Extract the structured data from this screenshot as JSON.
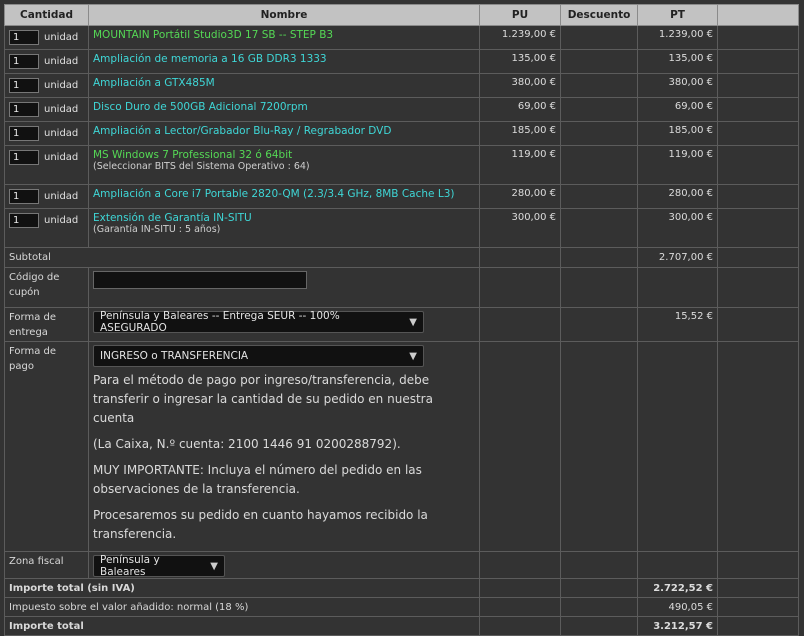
{
  "headers": {
    "quantity": "Cantidad",
    "name": "Nombre",
    "unit_price": "PU",
    "discount": "Descuento",
    "total_price": "PT"
  },
  "items": [
    {
      "qty": "1",
      "unit": "unidad",
      "name": "MOUNTAIN Portátil Studio3D 17 SB -- STEP B3",
      "sub": "",
      "pu": "1.239,00 €",
      "pt": "1.239,00 €",
      "color": "#55d955"
    },
    {
      "qty": "1",
      "unit": "unidad",
      "name": "Ampliación de memoria a 16 GB DDR3 1333",
      "sub": "",
      "pu": "135,00 €",
      "pt": "135,00 €",
      "color": "#3fd7d7"
    },
    {
      "qty": "1",
      "unit": "unidad",
      "name": "Ampliación a GTX485M",
      "sub": "",
      "pu": "380,00 €",
      "pt": "380,00 €",
      "color": "#3fd7d7"
    },
    {
      "qty": "1",
      "unit": "unidad",
      "name": "Disco Duro de 500GB Adicional 7200rpm",
      "sub": "",
      "pu": "69,00 €",
      "pt": "69,00 €",
      "color": "#3fd7d7"
    },
    {
      "qty": "1",
      "unit": "unidad",
      "name": "Ampliación a Lector/Grabador Blu-Ray / Regrabador DVD",
      "sub": "",
      "pu": "185,00 €",
      "pt": "185,00 €",
      "color": "#3fd7d7"
    },
    {
      "qty": "1",
      "unit": "unidad",
      "name": "MS Windows 7 Professional 32 ó 64bit",
      "sub": "(Seleccionar BITS del Sistema Operativo : 64)",
      "pu": "119,00 €",
      "pt": "119,00 €",
      "color": "#55d955"
    },
    {
      "qty": "1",
      "unit": "unidad",
      "name": "Ampliación a Core i7 Portable 2820-QM (2.3/3.4 GHz, 8MB Cache L3)",
      "sub": "",
      "pu": "280,00 €",
      "pt": "280,00 €",
      "color": "#3fd7d7"
    },
    {
      "qty": "1",
      "unit": "unidad",
      "name": "Extensión de Garantía IN-SITU",
      "sub": "(Garantía IN-SITU : 5 años)",
      "pu": "300,00 €",
      "pt": "300,00 €",
      "color": "#3fd7d7"
    }
  ],
  "subtotal": {
    "label": "Subtotal",
    "value": "2.707,00 €"
  },
  "coupon": {
    "label": "Código de cupón",
    "value": ""
  },
  "delivery": {
    "label": "Forma de entrega",
    "selected": "Península y Baleares -- Entrega SEUR -- 100% ASEGURADO",
    "price": "15,52 €"
  },
  "payment": {
    "label": "Forma de pago",
    "selected": "INGRESO o TRANSFERENCIA",
    "paragraphs": [
      "Para el método de pago por ingreso/transferencia, debe transferir o ingresar la cantidad de su pedido en nuestra cuenta",
      "(La Caixa, N.º cuenta: 2100 1446 91 0200288792).",
      "MUY IMPORTANTE: Incluya el número del pedido en las observaciones de la transferencia.",
      "Procesaremos su pedido en cuanto hayamos recibido la transferencia."
    ]
  },
  "tax_zone": {
    "label": "Zona fiscal",
    "selected": "Península y Baleares"
  },
  "total_no_vat": {
    "label": "Importe total (sin IVA)",
    "value": "2.722,52 €"
  },
  "vat": {
    "label": "Impuesto sobre el valor añadido: normal (18 %)",
    "value": "490,05 €"
  },
  "grand_total": {
    "label": "Importe total",
    "value": "3.212,57 €"
  },
  "colors": {
    "background": "#333333",
    "header": "#c2c2c2",
    "link_cyan": "#3fd7d7",
    "link_green": "#55d955"
  },
  "icons": {
    "dropdown": "triangle-down-icon"
  }
}
